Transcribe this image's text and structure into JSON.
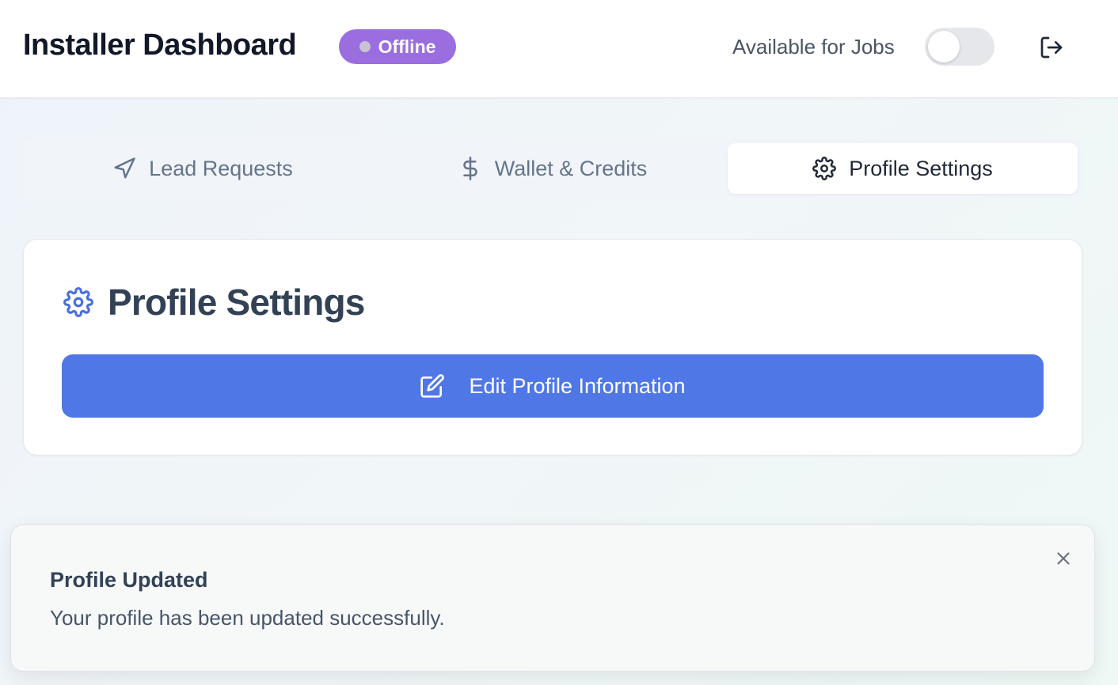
{
  "header": {
    "title": "Installer Dashboard",
    "status_label": "Offline",
    "availability_label": "Available for Jobs",
    "availability_on": false,
    "status_color": "#9b6ee0"
  },
  "tabs": [
    {
      "label": "Lead Requests",
      "icon": "send-icon",
      "active": false
    },
    {
      "label": "Wallet & Credits",
      "icon": "dollar-icon",
      "active": false
    },
    {
      "label": "Profile Settings",
      "icon": "gear-icon",
      "active": true
    }
  ],
  "card": {
    "title": "Profile Settings",
    "title_icon": "gear-icon",
    "edit_button_label": "Edit Profile Information",
    "accent_color": "#5077e6"
  },
  "toast": {
    "title": "Profile Updated",
    "message": "Your profile has been updated successfully."
  }
}
